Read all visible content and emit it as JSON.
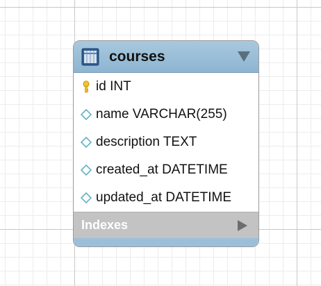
{
  "canvas": {
    "name": "er-diagram-canvas"
  },
  "table": {
    "name": "courses",
    "icon": "table-icon",
    "header_color": "#a9c8de",
    "collapse_icon": "triangle-down-icon",
    "columns": [
      {
        "label": "id INT",
        "icon": "primary-key-icon",
        "icon_color": "#f2c230"
      },
      {
        "label": "name VARCHAR(255)",
        "icon": "column-diamond-icon",
        "icon_color": "#5fb3c4"
      },
      {
        "label": "description TEXT",
        "icon": "column-diamond-icon",
        "icon_color": "#5fb3c4"
      },
      {
        "label": "created_at DATETIME",
        "icon": "column-diamond-icon",
        "icon_color": "#5fb3c4"
      },
      {
        "label": "updated_at DATETIME",
        "icon": "column-diamond-icon",
        "icon_color": "#5fb3c4"
      }
    ],
    "indexes": {
      "label": "Indexes",
      "icon": "triangle-right-icon",
      "bar_color": "#c3c3c3"
    },
    "footer_color": "#9cbfd9"
  }
}
